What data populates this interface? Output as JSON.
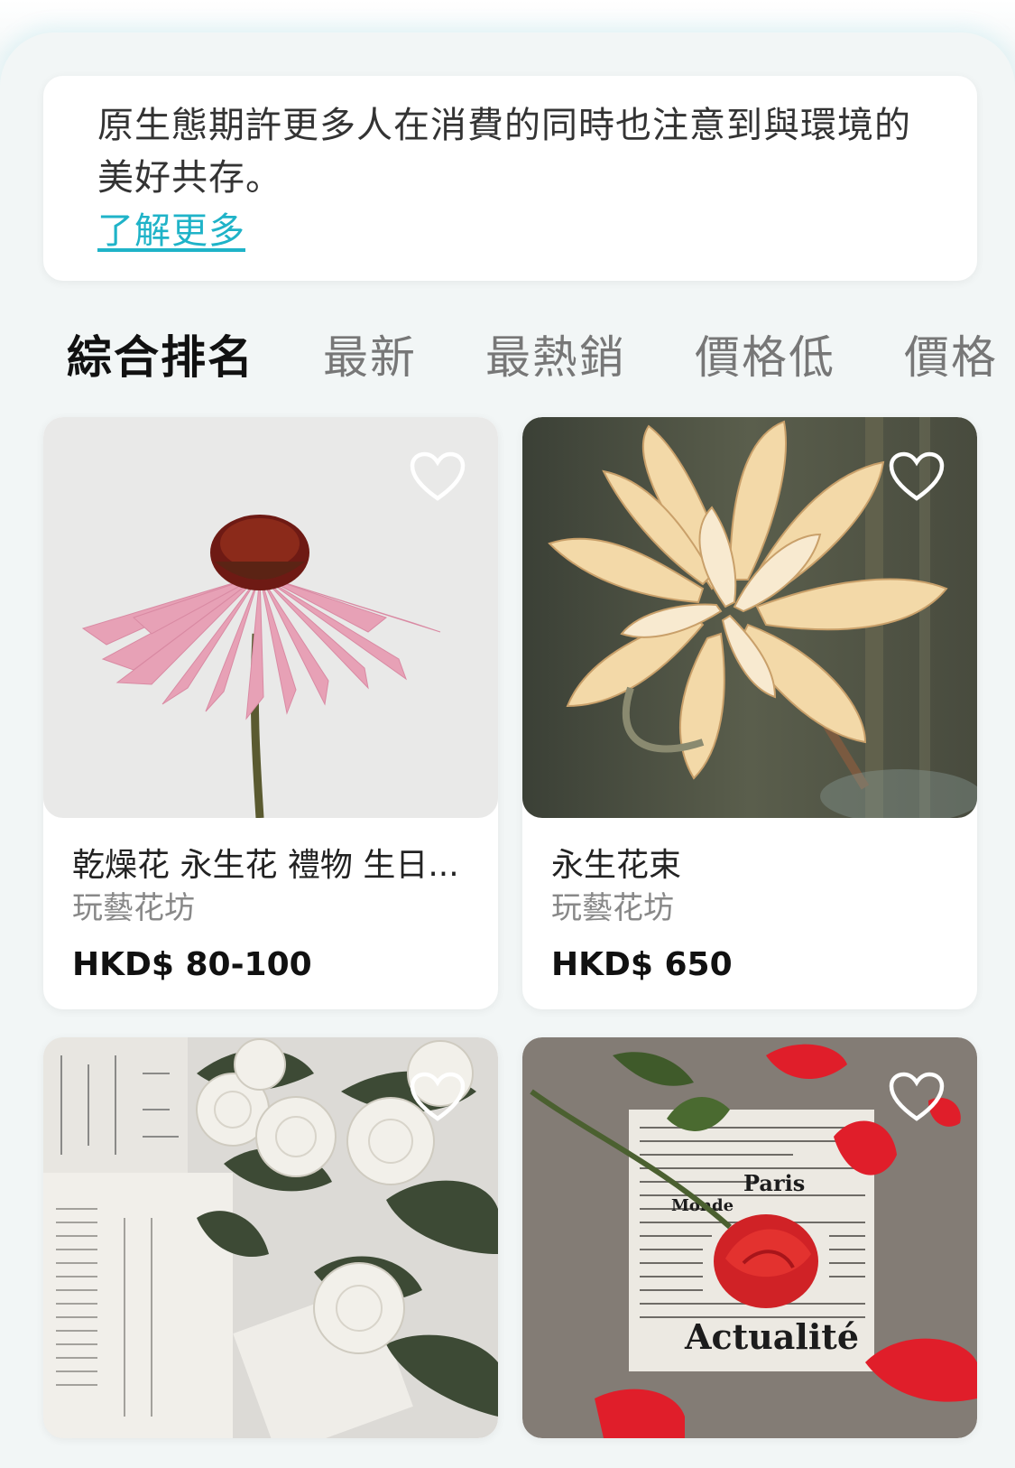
{
  "intro": {
    "text": "原生態期許更多人在消費的同時也注意到與環境的美好共存。",
    "link": "了解更多"
  },
  "sort_tabs": [
    {
      "label": "綜合排名",
      "active": true
    },
    {
      "label": "最新",
      "active": false
    },
    {
      "label": "最熱銷",
      "active": false
    },
    {
      "label": "價格低",
      "active": false
    },
    {
      "label": "價格",
      "active": false
    }
  ],
  "accent_color": "#1fb3c8",
  "products": [
    {
      "title": "乾燥花 永生花 禮物 生日...",
      "shop": "玩藝花坊",
      "price": "HKD$ 80-100",
      "icon": "heart-outline-icon"
    },
    {
      "title": "永生花束",
      "shop": "玩藝花坊",
      "price": "HKD$ 650",
      "icon": "heart-outline-icon"
    },
    {
      "title": "",
      "shop": "",
      "price": "",
      "icon": "heart-outline-icon"
    },
    {
      "title": "",
      "shop": "",
      "price": "",
      "icon": "heart-outline-icon"
    }
  ],
  "image_text": {
    "newspaper_1": "Paris",
    "newspaper_2": "Monde",
    "newspaper_3": "Actualité"
  }
}
